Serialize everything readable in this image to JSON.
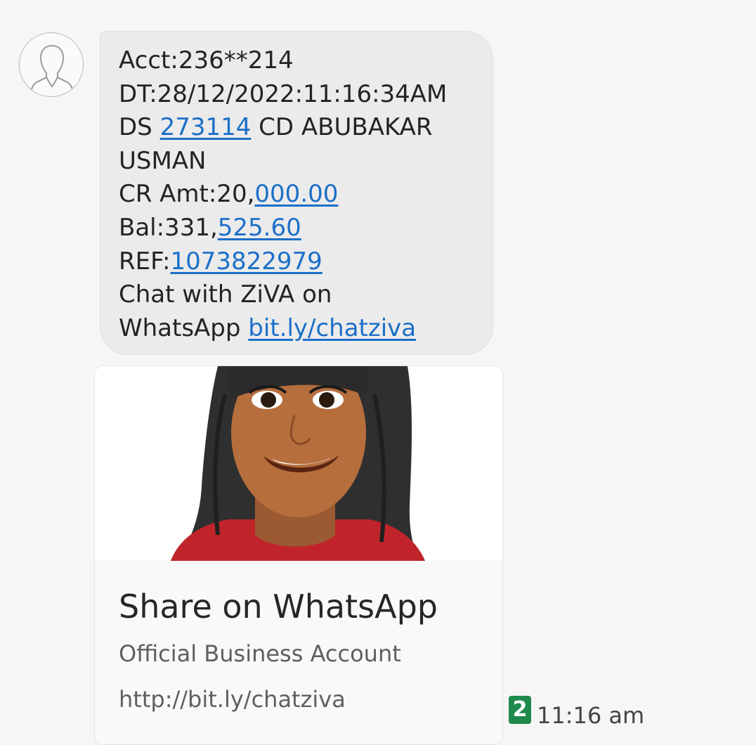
{
  "message": {
    "lines": [
      [
        {
          "t": "Acct:236**214"
        }
      ],
      [
        {
          "t": "DT:28/12/2022:11:16:34AM"
        }
      ],
      [
        {
          "t": "DS "
        },
        {
          "t": "273114",
          "link": true
        },
        {
          "t": " CD ABUBAKAR"
        }
      ],
      [
        {
          "t": "USMAN"
        }
      ],
      [
        {
          "t": "CR Amt:20,"
        },
        {
          "t": "000.00",
          "link": true
        }
      ],
      [
        {
          "t": "Bal:331,"
        },
        {
          "t": "525.60",
          "link": true
        }
      ],
      [
        {
          "t": "REF:"
        },
        {
          "t": "1073822979",
          "link": true
        }
      ],
      [
        {
          "t": "Chat with ZiVA on"
        }
      ],
      [
        {
          "t": "WhatsApp "
        },
        {
          "t": "bit.ly/chatziva",
          "link": true
        }
      ]
    ]
  },
  "preview_card": {
    "title": "Share on WhatsApp",
    "subtitle": "Official Business Account",
    "url": "http://bit.ly/chatziva"
  },
  "meta": {
    "sim_slot": "2",
    "time": "11:16 am"
  },
  "colors": {
    "bubble_bg": "#ebebeb",
    "link": "#1b6fc8",
    "sim_badge": "#1f8a4c",
    "background": "#f6f6f6"
  },
  "icons": {
    "avatar": "person-outline-icon",
    "preview_image": "ziva-character-image"
  }
}
